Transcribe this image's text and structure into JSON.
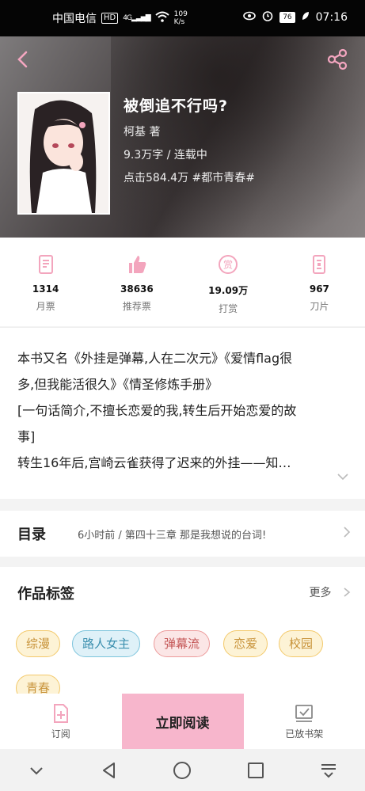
{
  "status_bar": {
    "carrier": "中国电信",
    "hd": "HD",
    "network": "4G",
    "speed_value": "109",
    "speed_unit": "K/s",
    "battery": "76",
    "time": "07:16"
  },
  "book": {
    "title": "被倒追不行吗?",
    "author": "柯基   著",
    "words_status": "9.3万字 / 连载中",
    "clicks_tag": "点击584.4万  #都市青春#"
  },
  "stats": [
    {
      "value": "1314",
      "label": "月票"
    },
    {
      "value": "38636",
      "label": "推荐票"
    },
    {
      "value": "19.09万",
      "label": "打赏"
    },
    {
      "value": "967",
      "label": "刀片"
    }
  ],
  "description": {
    "line1": "本书又名《外挂是弹幕,人在二次元》《爱情flag很",
    "line2": "多,但我能活很久》《情圣修炼手册》",
    "line3": "[一句话简介,不擅长恋爱的我,转生后开始恋爱的故",
    "line4": "事]",
    "line5": "转生16年后,宫崎云雀获得了迟来的外挂——知…"
  },
  "toc": {
    "title": "目录",
    "latest": "6小时前 / 第四十三章 那是我想说的台词!"
  },
  "tags_section": {
    "title": "作品标签",
    "more": "更多",
    "tags": [
      "综漫",
      "路人女主",
      "弹幕流",
      "恋爱",
      "校园",
      "青春"
    ]
  },
  "bottom_bar": {
    "subscribe": "订阅",
    "read_now": "立即阅读",
    "shelf": "已放书架"
  },
  "colors": {
    "accent_pink": "#f3a5bd",
    "read_button": "#f7b6cc"
  }
}
